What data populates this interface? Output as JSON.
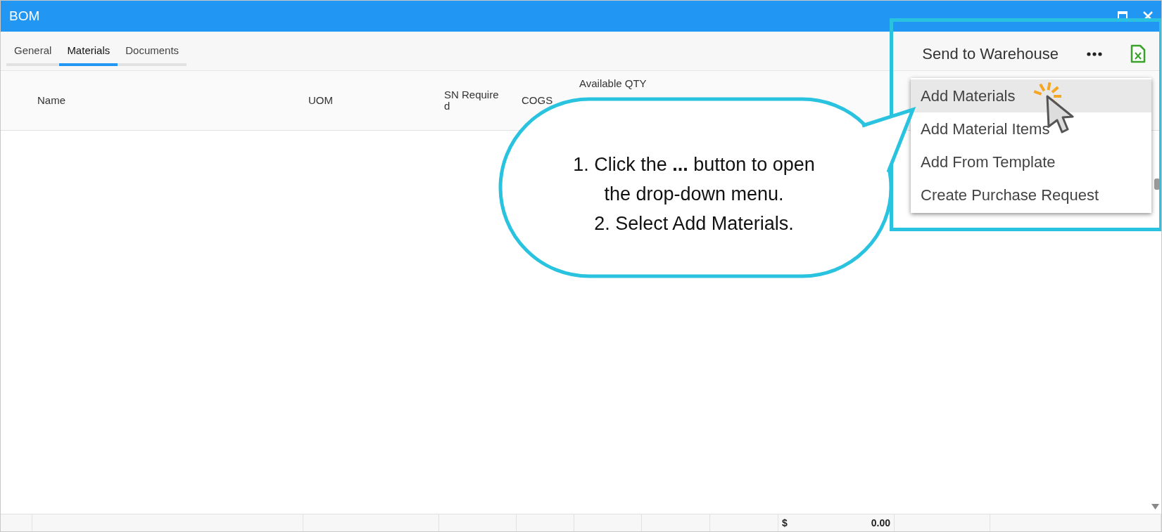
{
  "window": {
    "title": "BOM"
  },
  "tabs": [
    {
      "label": "General",
      "selected": false
    },
    {
      "label": "Materials",
      "selected": true
    },
    {
      "label": "Documents",
      "selected": false
    }
  ],
  "toolbar": {
    "send_label": "Send to Warehouse"
  },
  "menu": {
    "items": [
      {
        "label": "Add Materials",
        "selected": true
      },
      {
        "label": "Add Material Items",
        "selected": false
      },
      {
        "label": "Add From Template",
        "selected": false
      },
      {
        "label": "Create Purchase Request",
        "selected": false
      }
    ]
  },
  "table": {
    "columns": [
      "Name",
      "UOM",
      "SN Required",
      "COGS",
      "Available QTY"
    ],
    "footer": {
      "currency": "$",
      "total": "0.00"
    }
  },
  "callout": {
    "lines": [
      "1. Click the **...**  button to open",
      "the drop-down menu.",
      "2. Select Add Materials."
    ]
  }
}
